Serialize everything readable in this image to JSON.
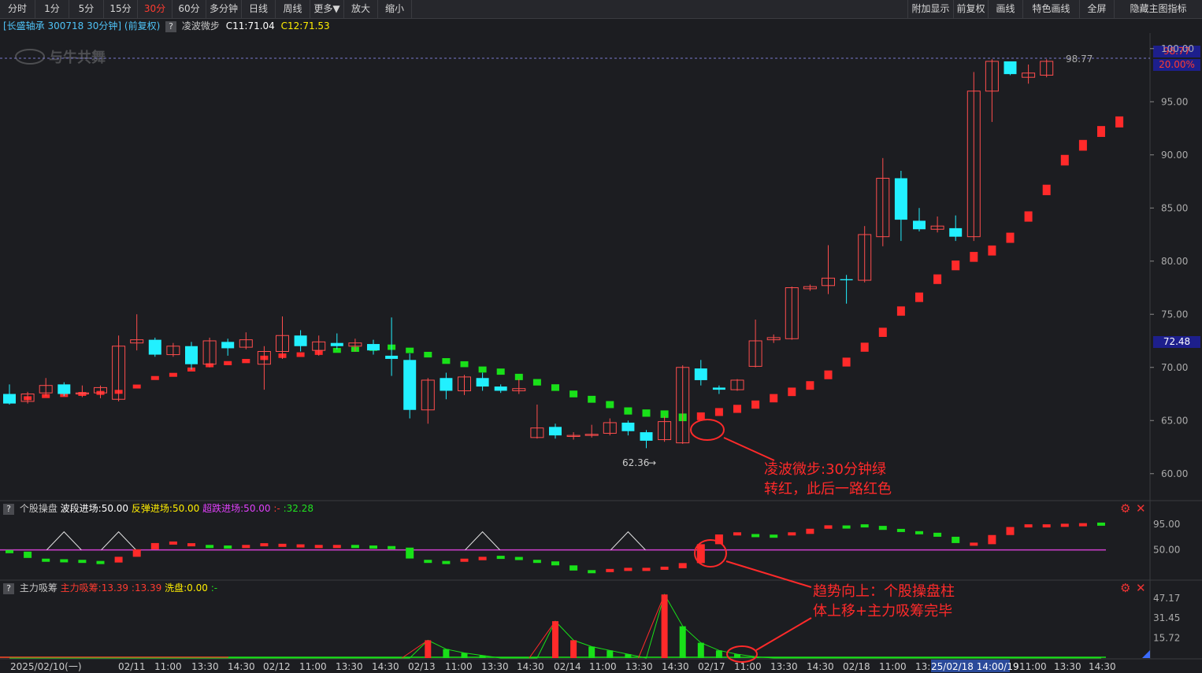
{
  "toolbar": {
    "left": [
      "分时",
      "1分",
      "5分",
      "15分",
      "30分",
      "60分",
      "多分钟",
      "日线",
      "周线",
      "更多▼",
      "放大",
      "缩小"
    ],
    "active": "30分",
    "right": [
      "附加显示",
      "前复权",
      "画线",
      "特色画线",
      "全屏",
      "隐藏主图指标"
    ]
  },
  "info": {
    "stock": "[长盛轴承 300718 30分钟] (前复权)",
    "indicator": "凌波微步",
    "c1": "C11:71.04",
    "c2": "C12:71.53"
  },
  "price_tags": {
    "high": "98.77",
    "pct": "20.00%",
    "mid": "72.48",
    "line_label": "98.77",
    "low_label": "62.36"
  },
  "watermark": "与牛共舞",
  "panel2": {
    "name": "个股操盘",
    "f1": "波段进场:50.00",
    "f2": "反弹进场:50.00",
    "f3": "超跌进场:50.00",
    "f4": ":-",
    "f5": ":32.28"
  },
  "panel3": {
    "name": "主力吸筹",
    "f1": "主力吸筹:13.39",
    "f2": ":13.39",
    "f3": "洗盘:0.00",
    "f4": ":-"
  },
  "annotations": {
    "a1_line1": "凌波微步:30分钟绿",
    "a1_line2": "转红，此后一路红色",
    "a2_line1": "趋势向上：个股操盘柱",
    "a2_line2": "体上移+主力吸筹完毕"
  },
  "x_axis": {
    "labels": [
      "2025/02/10(一)",
      "02/11",
      "11:00",
      "13:30",
      "14:30",
      "02/12",
      "11:00",
      "13:30",
      "14:30",
      "02/13",
      "11:00",
      "13:30",
      "14:30",
      "02/14",
      "11:00",
      "13:30",
      "14:30",
      "02/17",
      "11:00",
      "13:30",
      "14:30",
      "02/18",
      "11:00",
      "13:3",
      "25/02/18 14:00/19",
      "11:00",
      "13:30",
      "14:30"
    ],
    "cursor": "25/02/18 14:00/19"
  },
  "chart_data": [
    {
      "type": "candlestick",
      "title": "长盛轴承 300718 30分钟",
      "y_ticks": [
        "100.00",
        "95.00",
        "90.00",
        "85.00",
        "80.00",
        "75.00",
        "70.00",
        "65.00",
        "60.00"
      ],
      "ylim": [
        58.5,
        100.5
      ],
      "candles": [
        [
          67.5,
          66.6,
          68.4,
          66.5
        ],
        [
          66.8,
          67.5,
          67.7,
          66.6
        ],
        [
          67.6,
          68.3,
          69.0,
          67.3
        ],
        [
          68.4,
          67.5,
          68.6,
          67.3
        ],
        [
          67.5,
          67.6,
          68.3,
          67.2
        ],
        [
          67.6,
          68.1,
          68.3,
          67.1
        ],
        [
          67.0,
          72.0,
          73.0,
          66.8
        ],
        [
          72.3,
          72.6,
          75.0,
          71.6
        ],
        [
          72.6,
          71.2,
          72.8,
          71.0
        ],
        [
          71.2,
          72.0,
          72.3,
          71.0
        ],
        [
          72.0,
          70.3,
          72.4,
          69.8
        ],
        [
          70.3,
          72.5,
          72.8,
          70.0
        ],
        [
          72.4,
          71.8,
          72.7,
          71.1
        ],
        [
          71.9,
          72.6,
          73.3,
          71.7
        ],
        [
          70.3,
          71.5,
          72.0,
          67.9
        ],
        [
          71.5,
          73.0,
          74.8,
          70.8
        ],
        [
          73.0,
          72.0,
          73.5,
          71.5
        ],
        [
          71.6,
          72.4,
          73.0,
          71.1
        ],
        [
          72.3,
          72.0,
          73.2,
          71.7
        ],
        [
          72.0,
          72.3,
          72.7,
          71.5
        ],
        [
          72.2,
          71.6,
          72.6,
          71.2
        ],
        [
          71.1,
          70.8,
          74.7,
          69.2
        ],
        [
          70.7,
          66.0,
          71.3,
          65.2
        ],
        [
          66.0,
          68.8,
          69.0,
          64.7
        ],
        [
          69.0,
          67.8,
          69.5,
          67.0
        ],
        [
          67.8,
          69.1,
          69.3,
          67.4
        ],
        [
          69.0,
          68.2,
          69.5,
          67.8
        ],
        [
          68.2,
          67.8,
          68.4,
          67.6
        ],
        [
          67.8,
          68.0,
          68.9,
          67.5
        ],
        [
          63.4,
          64.3,
          66.5,
          63.3
        ],
        [
          64.4,
          63.6,
          64.7,
          63.3
        ],
        [
          63.5,
          63.6,
          63.9,
          63.2
        ],
        [
          63.6,
          63.7,
          64.6,
          63.4
        ],
        [
          63.8,
          64.8,
          65.2,
          63.6
        ],
        [
          64.8,
          64.0,
          65.0,
          63.6
        ],
        [
          63.9,
          63.1,
          64.1,
          62.4
        ],
        [
          63.2,
          64.9,
          65.4,
          63.0
        ],
        [
          62.9,
          70.0,
          70.2,
          62.8
        ],
        [
          69.9,
          68.8,
          70.7,
          68.3
        ],
        [
          68.1,
          67.9,
          68.3,
          67.5
        ],
        [
          67.9,
          68.8,
          68.9,
          67.8
        ],
        [
          70.1,
          72.5,
          74.5,
          70.0
        ],
        [
          72.6,
          72.8,
          73.1,
          72.3
        ],
        [
          72.7,
          77.5,
          77.6,
          72.6
        ],
        [
          77.4,
          77.6,
          77.8,
          77.2
        ],
        [
          77.7,
          78.4,
          81.5,
          76.9
        ],
        [
          78.3,
          78.2,
          78.7,
          76.0
        ],
        [
          78.2,
          82.5,
          83.3,
          78.0
        ],
        [
          82.3,
          87.8,
          89.7,
          81.4
        ],
        [
          87.8,
          83.9,
          88.5,
          81.9
        ],
        [
          83.8,
          83.0,
          85.0,
          82.8
        ],
        [
          83.0,
          83.3,
          84.2,
          82.7
        ],
        [
          83.1,
          82.3,
          84.3,
          81.9
        ],
        [
          82.3,
          96.0,
          97.8,
          81.9
        ],
        [
          96.0,
          98.8,
          99.0,
          93.1
        ],
        [
          98.8,
          97.6,
          98.8,
          97.5
        ],
        [
          97.3,
          97.7,
          98.5,
          96.7
        ],
        [
          97.5,
          98.8,
          99.0,
          97.3
        ]
      ],
      "line": [
        [
          66.9,
          "r"
        ],
        [
          67.1,
          "r"
        ],
        [
          67.3,
          "r"
        ],
        [
          67.4,
          "r"
        ],
        [
          67.5,
          "r"
        ],
        [
          67.6,
          "r"
        ],
        [
          67.7,
          "r"
        ],
        [
          68.2,
          "r"
        ],
        [
          69.0,
          "r"
        ],
        [
          69.3,
          "r"
        ],
        [
          69.8,
          "r"
        ],
        [
          70.2,
          "r"
        ],
        [
          70.4,
          "r"
        ],
        [
          70.6,
          "r"
        ],
        [
          70.9,
          "r"
        ],
        [
          71.1,
          "r"
        ],
        [
          71.2,
          "r"
        ],
        [
          71.4,
          "r"
        ],
        [
          71.6,
          "g"
        ],
        [
          71.7,
          "g"
        ],
        [
          71.8,
          "g"
        ],
        [
          71.9,
          "g"
        ],
        [
          71.6,
          "g"
        ],
        [
          71.2,
          "g"
        ],
        [
          70.6,
          "g"
        ],
        [
          70.3,
          "g"
        ],
        [
          69.8,
          "g"
        ],
        [
          69.6,
          "g"
        ],
        [
          69.1,
          "g"
        ],
        [
          68.6,
          "g"
        ],
        [
          68.1,
          "g"
        ],
        [
          67.5,
          "g"
        ],
        [
          67.0,
          "g"
        ],
        [
          66.5,
          "g"
        ],
        [
          65.9,
          "g"
        ],
        [
          65.7,
          "g"
        ],
        [
          65.6,
          "g"
        ],
        [
          65.3,
          "g"
        ],
        [
          65.4,
          "r"
        ],
        [
          65.8,
          "r"
        ],
        [
          66.1,
          "r"
        ],
        [
          66.5,
          "r"
        ],
        [
          67.1,
          "r"
        ],
        [
          67.7,
          "r"
        ],
        [
          68.3,
          "r"
        ],
        [
          69.3,
          "r"
        ],
        [
          70.5,
          "r"
        ],
        [
          71.9,
          "r"
        ],
        [
          73.3,
          "r"
        ],
        [
          75.3,
          "r"
        ],
        [
          76.6,
          "r"
        ],
        [
          78.3,
          "r"
        ],
        [
          79.6,
          "r"
        ],
        [
          80.4,
          "r"
        ],
        [
          81.0,
          "r"
        ],
        [
          82.2,
          "r"
        ],
        [
          84.2,
          "r"
        ],
        [
          86.7,
          "r"
        ],
        [
          89.5,
          "r"
        ],
        [
          90.9,
          "r"
        ],
        [
          92.2,
          "r"
        ],
        [
          93.1,
          "r"
        ]
      ]
    },
    {
      "type": "bar",
      "title": "个股操盘",
      "y_ticks": [
        "95.00",
        "50.00"
      ],
      "ylim": [
        0,
        110
      ],
      "reference_line": 50,
      "values": [
        [
          47,
          "g"
        ],
        [
          36,
          "g"
        ],
        [
          32,
          "g"
        ],
        [
          31,
          "g"
        ],
        [
          30,
          "g"
        ],
        [
          28,
          "g"
        ],
        [
          38,
          "r"
        ],
        [
          51,
          "r"
        ],
        [
          62,
          "r"
        ],
        [
          62,
          "r"
        ],
        [
          59,
          "r"
        ],
        [
          56,
          "g"
        ],
        [
          55,
          "g"
        ],
        [
          56,
          "r"
        ],
        [
          59,
          "r"
        ],
        [
          58,
          "r"
        ],
        [
          57,
          "r"
        ],
        [
          56,
          "r"
        ],
        [
          56,
          "r"
        ],
        [
          56,
          "g"
        ],
        [
          55,
          "g"
        ],
        [
          54,
          "g"
        ],
        [
          35,
          "g"
        ],
        [
          30,
          "g"
        ],
        [
          28,
          "g"
        ],
        [
          32,
          "r"
        ],
        [
          38,
          "r"
        ],
        [
          37,
          "g"
        ],
        [
          35,
          "g"
        ],
        [
          30,
          "g"
        ],
        [
          23,
          "g"
        ],
        [
          14,
          "g"
        ],
        [
          12,
          "g"
        ],
        [
          14,
          "r"
        ],
        [
          16,
          "r"
        ],
        [
          16,
          "r"
        ],
        [
          18,
          "r"
        ],
        [
          27,
          "r"
        ],
        [
          60,
          "r"
        ],
        [
          77,
          "r"
        ],
        [
          78,
          "r"
        ],
        [
          75,
          "g"
        ],
        [
          74,
          "g"
        ],
        [
          78,
          "r"
        ],
        [
          87,
          "r"
        ],
        [
          93,
          "r"
        ],
        [
          90,
          "g"
        ],
        [
          92,
          "g"
        ],
        [
          85,
          "g"
        ],
        [
          84,
          "g"
        ],
        [
          80,
          "g"
        ],
        [
          73,
          "g"
        ],
        [
          62,
          "g"
        ],
        [
          60,
          "r"
        ],
        [
          76,
          "r"
        ],
        [
          90,
          "r"
        ],
        [
          92,
          "r"
        ],
        [
          92,
          "r"
        ],
        [
          93,
          "r"
        ],
        [
          94,
          "r"
        ],
        [
          95,
          "g"
        ]
      ]
    },
    {
      "type": "bar",
      "title": "主力吸筹",
      "y_ticks": [
        "47.17",
        "31.45",
        "15.72"
      ],
      "ylim": [
        0,
        52
      ],
      "values": [
        [
          0,
          "r"
        ],
        [
          0,
          "r"
        ],
        [
          0,
          "r"
        ],
        [
          0,
          "r"
        ],
        [
          0,
          "r"
        ],
        [
          0,
          "r"
        ],
        [
          0,
          "r"
        ],
        [
          0,
          "r"
        ],
        [
          0,
          "r"
        ],
        [
          0,
          "r"
        ],
        [
          0,
          "r"
        ],
        [
          0,
          "r"
        ],
        [
          0,
          "r"
        ],
        [
          0,
          "r"
        ],
        [
          0,
          "g"
        ],
        [
          0,
          "g"
        ],
        [
          0,
          "g"
        ],
        [
          0,
          "g"
        ],
        [
          0,
          "g"
        ],
        [
          0,
          "g"
        ],
        [
          0,
          "g"
        ],
        [
          0,
          "g"
        ],
        [
          0,
          "g"
        ],
        [
          14,
          "r"
        ],
        [
          7,
          "g"
        ],
        [
          4,
          "g"
        ],
        [
          2,
          "g"
        ],
        [
          0,
          "g"
        ],
        [
          0,
          "g"
        ],
        [
          0,
          "g"
        ],
        [
          29,
          "r"
        ],
        [
          14,
          "r"
        ],
        [
          9,
          "g"
        ],
        [
          6,
          "g"
        ],
        [
          3,
          "g"
        ],
        [
          0,
          "g"
        ],
        [
          50,
          "r"
        ],
        [
          25,
          "g"
        ],
        [
          12,
          "g"
        ],
        [
          6,
          "g"
        ],
        [
          3,
          "g"
        ],
        [
          1,
          "g"
        ],
        [
          0,
          "g"
        ],
        [
          0,
          "g"
        ],
        [
          0,
          "g"
        ],
        [
          0,
          "g"
        ],
        [
          0,
          "g"
        ],
        [
          0,
          "g"
        ],
        [
          0,
          "g"
        ],
        [
          0,
          "g"
        ],
        [
          0,
          "g"
        ],
        [
          0,
          "g"
        ],
        [
          0,
          "g"
        ],
        [
          0,
          "g"
        ],
        [
          0,
          "g"
        ],
        [
          0,
          "g"
        ],
        [
          0,
          "g"
        ],
        [
          0,
          "g"
        ],
        [
          0,
          "g"
        ],
        [
          0,
          "g"
        ],
        [
          0,
          "g"
        ]
      ]
    }
  ]
}
